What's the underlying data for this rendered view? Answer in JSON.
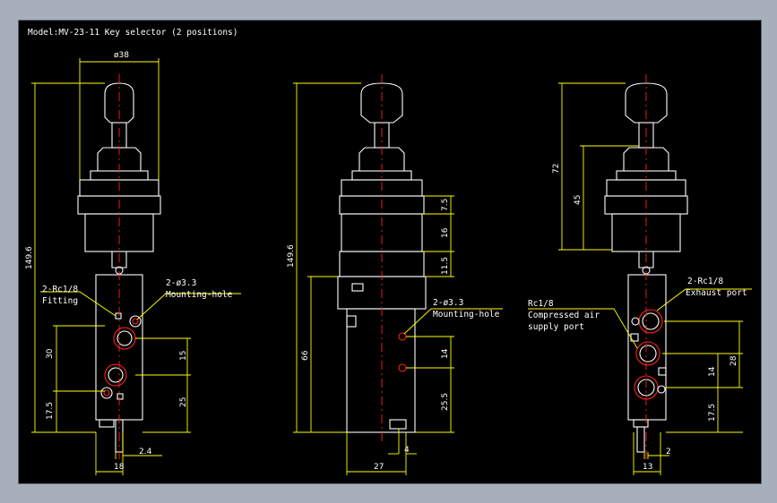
{
  "title": "Model:MV-23-11 Key selector (2 positions)",
  "colors": {
    "background": "#000000",
    "outline": "#ffffff",
    "dimension": "#ffff00",
    "centerline": "#ff2020"
  },
  "views": {
    "left": {
      "dims": {
        "dia38": "ø38",
        "h149_6": "149.6",
        "h30": "30",
        "h17_5": "17.5",
        "h15": "15",
        "h25": "25",
        "w2_4": "2.4",
        "w18": "18"
      },
      "labels": {
        "fitting_1": "2-Rc1/8",
        "fitting_2": "Fitting",
        "mount_1": "2-ø3.3",
        "mount_2": "Mounting-hole"
      }
    },
    "middle": {
      "dims": {
        "h149_6": "149.6",
        "h66": "66",
        "h7_5": "7.5",
        "h16": "16",
        "h11_5": "11.5",
        "h14": "14",
        "h25_5": "25.5",
        "w4": "4",
        "w27": "27"
      },
      "labels": {
        "mount_1": "2-ø3.3",
        "mount_2": "Mounting-hole"
      }
    },
    "right": {
      "dims": {
        "h72": "72",
        "h45": "45",
        "h28": "28",
        "h14": "14",
        "h17_5": "17.5",
        "w2": "2",
        "w13": "13"
      },
      "labels": {
        "exhaust_1": "2-Rc1/8",
        "exhaust_2": "Exhaust port",
        "supply_1": "Rc1/8",
        "supply_2": "Compressed air",
        "supply_3": "supply port"
      }
    }
  }
}
